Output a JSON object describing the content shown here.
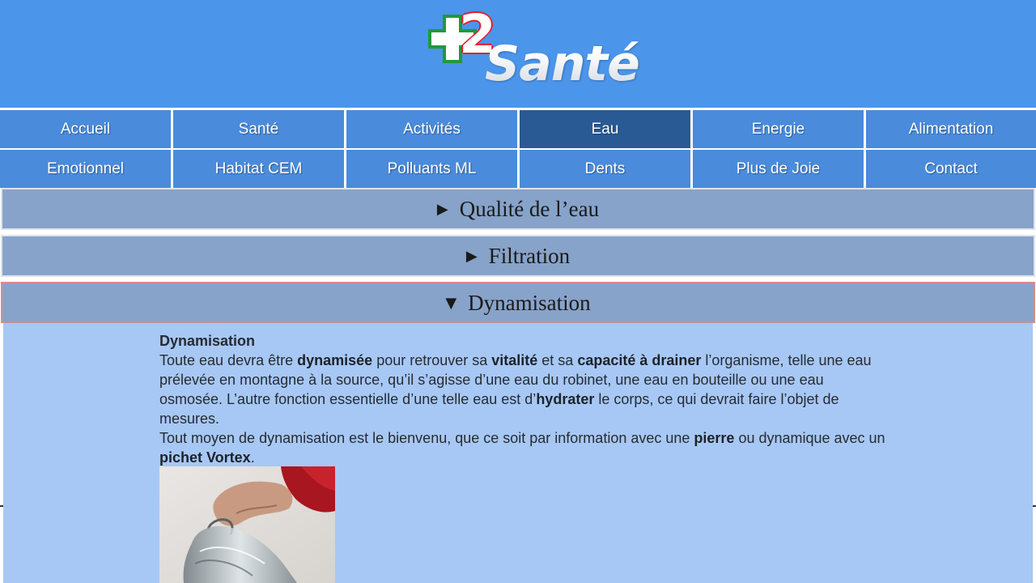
{
  "header": {
    "logo_cross_text": "+",
    "logo_number": "2",
    "logo_word": "Santé",
    "colors": {
      "background": "#4b95ea",
      "cross_green": "#1f9a3a",
      "two_red": "#e31b23"
    }
  },
  "nav": {
    "row1": [
      {
        "label": "Accueil"
      },
      {
        "label": "Santé"
      },
      {
        "label": "Activités"
      },
      {
        "label": "Eau",
        "active": true
      },
      {
        "label": "Energie"
      },
      {
        "label": "Alimentation"
      }
    ],
    "row2": [
      {
        "label": "Emotionnel"
      },
      {
        "label": "Habitat CEM"
      },
      {
        "label": "Polluants ML"
      },
      {
        "label": "Dents"
      },
      {
        "label": "Plus de Joie"
      },
      {
        "label": "Contact"
      }
    ],
    "colors": {
      "item": "#4a8bdc",
      "active": "#2a5a94"
    }
  },
  "accordion": [
    {
      "label": "Qualité de l’eau",
      "icon": "triangle-right-icon",
      "glyph": "▶",
      "expanded": false
    },
    {
      "label": "Filtration",
      "icon": "triangle-right-icon",
      "glyph": "▶",
      "expanded": false
    },
    {
      "label": "Dynamisation",
      "icon": "triangle-down-icon",
      "glyph": "▼",
      "expanded": true
    }
  ],
  "panel": {
    "heading": "Dynamisation",
    "p1": {
      "t1": "Toute eau devra être ",
      "b1": "dynamisée",
      "t2": " pour retrouver sa ",
      "b2": "vitalité",
      "t3": " et sa ",
      "b3": "capacité à drainer",
      "t4": " l’organisme, telle une eau prélevée en montagne à la source, qu’il s’agisse d’une eau du robinet, une eau en bouteille ou une eau osmosée. L’autre fonction essentielle d’une telle eau est d’",
      "b4": "hydrater",
      "t5": " le corps, ce qui devrait faire l’objet de mesures."
    },
    "p2": {
      "t1": "Tout moyen de dynamisation est le bienvenu, que ce soit par information avec une ",
      "b1": "pierre",
      "t2": " ou dynamique avec  un ",
      "b2": "pichet Vortex",
      "t3": "."
    },
    "image": "photo of hand pouring water from glass pitcher",
    "colors": {
      "background": "#a7c8f4",
      "accordion": "#87a3c9"
    }
  }
}
